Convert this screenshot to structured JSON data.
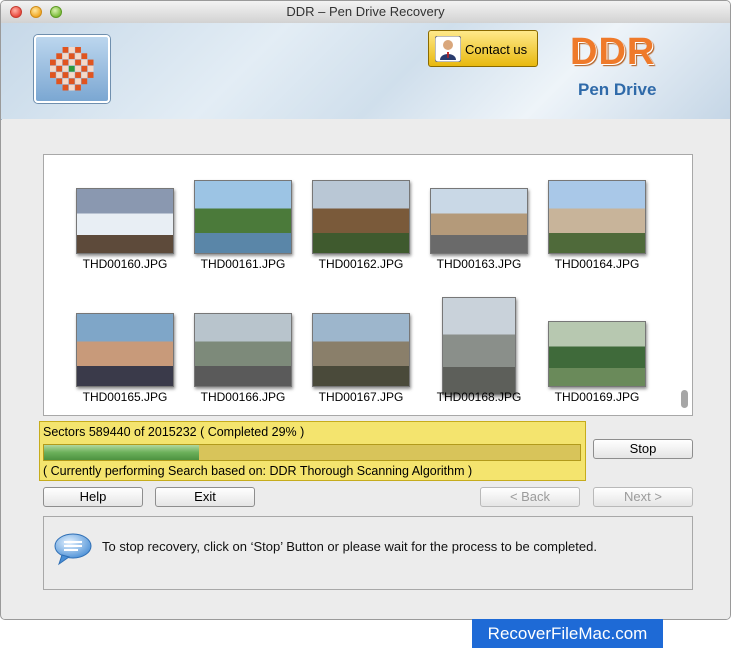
{
  "window": {
    "title": "DDR – Pen Drive Recovery"
  },
  "header": {
    "contact_label": "Contact us",
    "brand_title": "DDR",
    "brand_subtitle": "Pen Drive"
  },
  "thumbnails": [
    {
      "name": "THD00160.JPG",
      "scene": "snow-lift"
    },
    {
      "name": "THD00161.JPG",
      "scene": "river-crowd"
    },
    {
      "name": "THD00162.JPG",
      "scene": "mountain-cliff"
    },
    {
      "name": "THD00163.JPG",
      "scene": "city-parade"
    },
    {
      "name": "THD00164.JPG",
      "scene": "street-building"
    },
    {
      "name": "THD00165.JPG",
      "scene": "people-group"
    },
    {
      "name": "THD00166.JPG",
      "scene": "town-cars"
    },
    {
      "name": "THD00167.JPG",
      "scene": "bridge-woman"
    },
    {
      "name": "THD00168.JPG",
      "scene": "sky-hill"
    },
    {
      "name": "THD00169.JPG",
      "scene": "forest-trees"
    }
  ],
  "progress": {
    "status": "Sectors 589440 of 2015232    ( Completed 29% )",
    "percent": 29,
    "algorithm": "( Currently performing Search based on: DDR Thorough Scanning Algorithm )"
  },
  "buttons": {
    "stop": "Stop",
    "help": "Help",
    "exit": "Exit",
    "back": "< Back",
    "next": "Next >"
  },
  "info": {
    "message": "To stop recovery, click on ‘Stop’ Button or please wait for the process to be completed."
  },
  "footer": {
    "badge": "RecoverFileMac.com"
  },
  "colors": {
    "accent_orange": "#ef7a2a",
    "accent_blue": "#2f6aa9",
    "progress_panel": "#f4e46e",
    "progress_fill": "#6bb05a",
    "footer_blue": "#1e6ad6"
  }
}
